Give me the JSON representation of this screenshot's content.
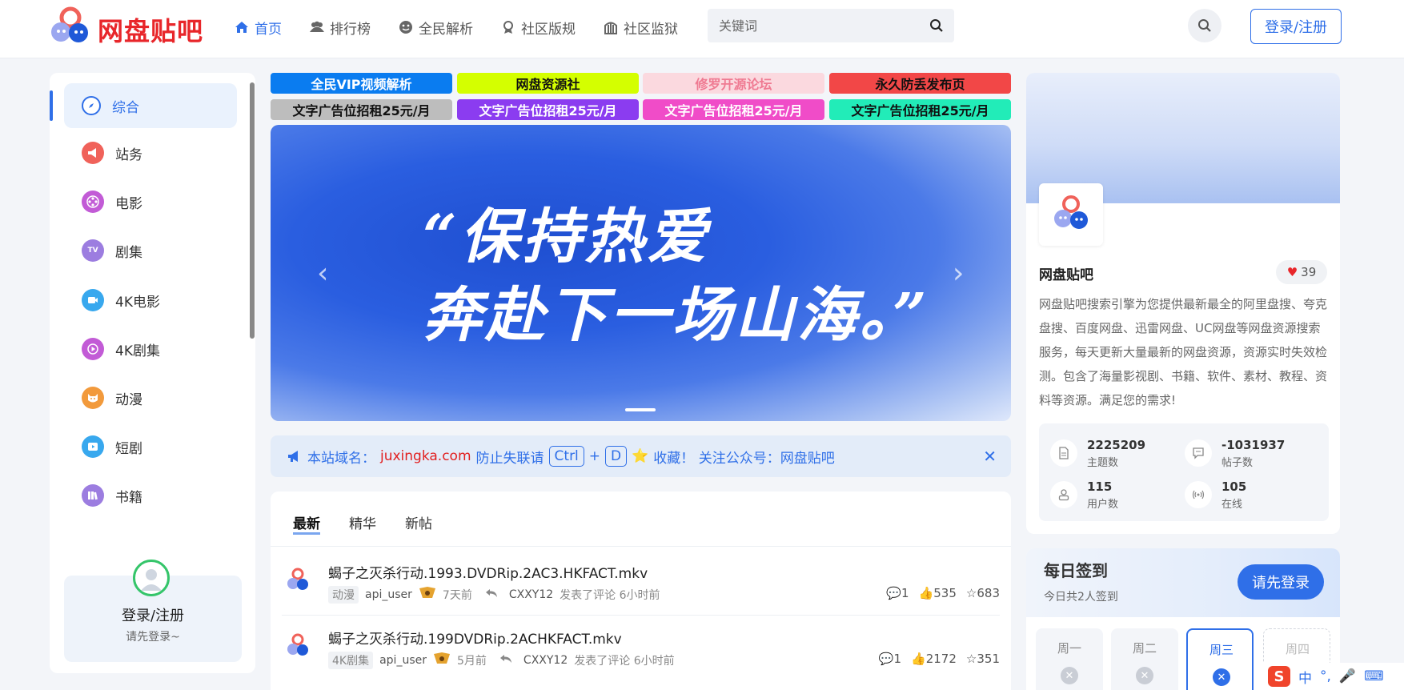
{
  "brand": {
    "name": "网盘贴吧",
    "accent": "#2f6fe8",
    "red": "#e8262a"
  },
  "nav": [
    {
      "label": "首页",
      "icon": "home-icon",
      "active": true
    },
    {
      "label": "排行榜",
      "icon": "users-icon"
    },
    {
      "label": "全民解析",
      "icon": "face-icon"
    },
    {
      "label": "社区版规",
      "icon": "award-icon"
    },
    {
      "label": "社区监狱",
      "icon": "prison-icon"
    }
  ],
  "search": {
    "placeholder": "关键词"
  },
  "header": {
    "login_label": "登录/注册"
  },
  "sidebar": {
    "items": [
      {
        "label": "综合",
        "icon": "compass-icon",
        "color": "#2f6fe8"
      },
      {
        "label": "站务",
        "icon": "megaphone-icon",
        "color": "#f0625a"
      },
      {
        "label": "电影",
        "icon": "film-reel-icon",
        "color": "#c25bd6"
      },
      {
        "label": "剧集",
        "icon": "tv-icon",
        "color": "#9c7de0"
      },
      {
        "label": "4K电影",
        "icon": "camera-icon",
        "color": "#38a8ee"
      },
      {
        "label": "4K剧集",
        "icon": "play-icon",
        "color": "#c25bd6"
      },
      {
        "label": "动漫",
        "icon": "cat-icon",
        "color": "#f29a3c"
      },
      {
        "label": "短剧",
        "icon": "video-icon",
        "color": "#38a8ee"
      },
      {
        "label": "书籍",
        "icon": "books-icon",
        "color": "#9c7de0"
      }
    ],
    "user": {
      "name": "登录/注册",
      "tip": "请先登录~"
    }
  },
  "ads": [
    {
      "label": "全民VIP视频解析",
      "bg": "#0a7cf0",
      "fg": "#ffffff"
    },
    {
      "label": "网盘资源社",
      "bg": "#d4ff00",
      "fg": "#111111"
    },
    {
      "label": "修罗开源论坛",
      "bg": "#fbd9df",
      "fg": "#ef7a92"
    },
    {
      "label": "永久防丢发布页",
      "bg": "#f24747",
      "fg": "#111111"
    },
    {
      "label": "文字广告位招租25元/月",
      "bg": "#bdbdbd",
      "fg": "#111111"
    },
    {
      "label": "文字广告位招租25元/月",
      "bg": "#8b3cf0",
      "fg": "#ffffff"
    },
    {
      "label": "文字广告位招租25元/月",
      "bg": "#f04cc8",
      "fg": "#ffffff"
    },
    {
      "label": "文字广告位招租25元/月",
      "bg": "#22ecb8",
      "fg": "#111111"
    }
  ],
  "banner": {
    "line1": "“保持热爱",
    "line2": "奔赴下一场山海。”"
  },
  "notice": {
    "prefix": "本站域名：",
    "domain": "juxingka.com",
    "mid": "防止失联请",
    "key1": "Ctrl",
    "plus": "+",
    "key2": "D",
    "star": "⭐",
    "suffix": "收藏！  关注公众号：网盘贴吧"
  },
  "posts": {
    "tabs": [
      "最新",
      "精华",
      "新帖"
    ],
    "items": [
      {
        "title": "蝎子之灭杀行动.1993.DVDRip.2AC3.HKFACT.mkv",
        "tag": "动漫",
        "user": "api_user",
        "time": "7天前",
        "replier": "CXXY12",
        "reply_text": "发表了评论 6小时前",
        "comments": "1",
        "likes": "535",
        "stars": "683"
      },
      {
        "title": "蝎子之灭杀行动.199DVDRip.2ACHKFACT.mkv",
        "tag": "4K剧集",
        "user": "api_user",
        "time": "5月前",
        "replier": "CXXY12",
        "reply_text": "发表了评论 6小时前",
        "comments": "1",
        "likes": "2172",
        "stars": "351"
      }
    ]
  },
  "site": {
    "name": "网盘贴吧",
    "likes": "39",
    "desc": "网盘贴吧搜索引擎为您提供最新最全的阿里盘搜、夸克盘搜、百度网盘、迅雷网盘、UC网盘等网盘资源搜索服务，每天更新大量最新的网盘资源，资源实时失效检测。包含了海量影视剧、书籍、软件、素材、教程、资料等资源。满足您的需求!",
    "stats": [
      {
        "num": "2225209",
        "label": "主题数",
        "icon": "document-icon"
      },
      {
        "num": "-1031937",
        "label": "帖子数",
        "icon": "message-icon"
      },
      {
        "num": "115",
        "label": "用户数",
        "icon": "user-icon"
      },
      {
        "num": "105",
        "label": "在线",
        "icon": "signal-icon"
      }
    ]
  },
  "signin": {
    "title": "每日签到",
    "sub": "今日共2人签到",
    "button": "请先登录",
    "days": [
      "周一",
      "周二",
      "周三",
      "周四"
    ]
  },
  "ime": {
    "label": "中"
  }
}
